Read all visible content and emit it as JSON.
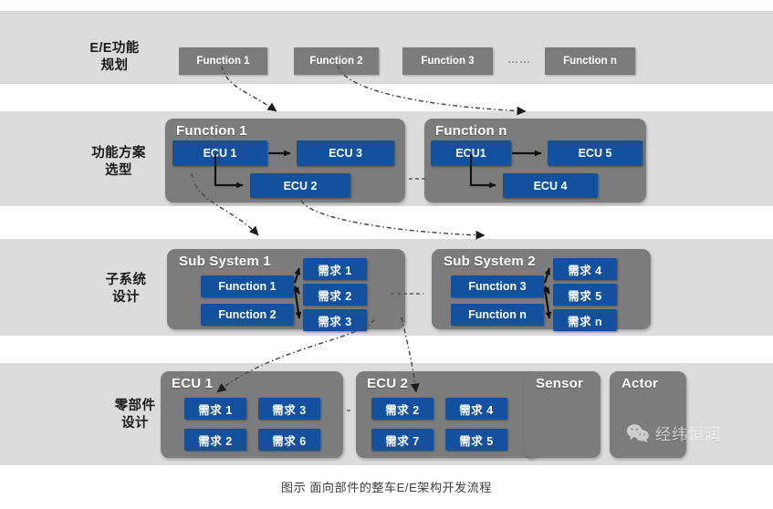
{
  "caption": "图示 面向部件的整车E/E架构开发流程",
  "watermark": {
    "icon": "wechat-icon",
    "text": "经纬恒润"
  },
  "colors": {
    "band": "#dcdcdc",
    "grey_box": "#7b7b7b",
    "group_box": "#7c7c7c",
    "blue_box": "#13519e",
    "arrow": "#000000",
    "page_background": "#ffffff"
  },
  "bands": [
    {
      "id": "ee-function-planning",
      "label": "E/E功能\n规划",
      "items": [
        {
          "label": "Function 1"
        },
        {
          "label": "Function 2"
        },
        {
          "label": "Function 3"
        },
        {
          "label": "……"
        },
        {
          "label": "Function n"
        }
      ]
    },
    {
      "id": "function-solution-selection",
      "label": "功能方案\n选型",
      "groups": [
        {
          "title": "Function 1",
          "nodes": [
            {
              "label": "ECU 1"
            },
            {
              "label": "ECU 3"
            },
            {
              "label": "ECU 2"
            }
          ]
        },
        {
          "title": "Function n",
          "nodes": [
            {
              "label": "ECU1"
            },
            {
              "label": "ECU 5"
            },
            {
              "label": "ECU 4"
            }
          ]
        }
      ]
    },
    {
      "id": "sub-system-design",
      "label": "子系统\n设计",
      "groups": [
        {
          "title": "Sub System 1",
          "functions": [
            {
              "label": "Function 1"
            },
            {
              "label": "Function 2"
            }
          ],
          "requirements": [
            {
              "label": "需求 1"
            },
            {
              "label": "需求 2"
            },
            {
              "label": "需求 3"
            }
          ]
        },
        {
          "title": "Sub System 2",
          "functions": [
            {
              "label": "Function 3"
            },
            {
              "label": "Function n"
            }
          ],
          "requirements": [
            {
              "label": "需求 4"
            },
            {
              "label": "需求 5"
            },
            {
              "label": "需求 n"
            }
          ]
        }
      ]
    },
    {
      "id": "component-design",
      "label": "零部件\n设计",
      "groups": [
        {
          "title": "ECU 1",
          "requirements": [
            {
              "label": "需求 1"
            },
            {
              "label": "需求 3"
            },
            {
              "label": "需求 2"
            },
            {
              "label": "需求 6"
            }
          ]
        },
        {
          "title": "ECU 2",
          "requirements": [
            {
              "label": "需求 2"
            },
            {
              "label": "需求 4"
            },
            {
              "label": "需求 7"
            },
            {
              "label": "需求 5"
            }
          ]
        },
        {
          "title": "Sensor",
          "requirements": []
        },
        {
          "title": "Actor",
          "requirements": []
        }
      ]
    }
  ]
}
